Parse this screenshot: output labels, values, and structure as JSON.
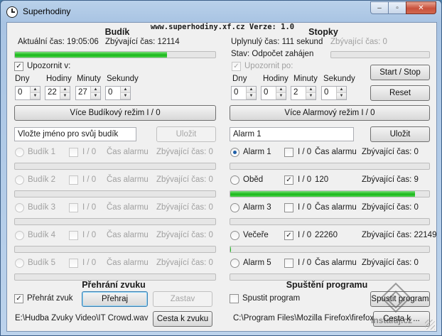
{
  "window": {
    "title": "Superhodiny",
    "caption_min": "–",
    "caption_max": "▫",
    "caption_close": "✕"
  },
  "header": {
    "site": "www.superhodiny.xf.cz  Verze: 1.0"
  },
  "budik": {
    "title": "Budík",
    "current_time": "Aktuální čas: 19:05:06",
    "remaining": "Zbývající čas: 12114",
    "progress": 0.76,
    "notify_label": "Upozornit v:",
    "notify_checked": "✓",
    "labels": {
      "dny": "Dny",
      "hodiny": "Hodiny",
      "minuty": "Minuty",
      "sekundy": "Sekundy"
    },
    "values": {
      "dny": "0",
      "hodiny": "22",
      "minuty": "27",
      "sekundy": "0"
    },
    "mode_button": "Více Budíkový režim I / 0",
    "name_input": "Vložte jméno pro svůj budík",
    "save_button": "Uložit",
    "items": [
      {
        "name": "Budík 1",
        "io": "I / 0",
        "time": "Čas alarmu",
        "remaining": "Zbývající čas: 0"
      },
      {
        "name": "Budík 2",
        "io": "I / 0",
        "time": "Čas alarmu",
        "remaining": "Zbývající čas: 0"
      },
      {
        "name": "Budík 3",
        "io": "I / 0",
        "time": "Čas alarmu",
        "remaining": "Zbývající čas: 0"
      },
      {
        "name": "Budík 4",
        "io": "I / 0",
        "time": "Čas alarmu",
        "remaining": "Zbývající čas: 0"
      },
      {
        "name": "Budík 5",
        "io": "I / 0",
        "time": "Čas alarmu",
        "remaining": "Zbývající čas: 0"
      }
    ]
  },
  "stopky": {
    "title": "Stopky",
    "elapsed": "Uplynulý čas: 111 sekund",
    "remaining": "Zbývající čas: 0",
    "state": "Stav: Odpočet zahájen",
    "notify_label": "Upozornit po:",
    "notify_checked": "✓",
    "labels": {
      "dny": "Dny",
      "hodiny": "Hodiny",
      "minuty": "Minuty",
      "sekundy": "Sekundy"
    },
    "values": {
      "dny": "0",
      "hodiny": "0",
      "minuty": "2",
      "sekundy": "0"
    },
    "start_stop": "Start / Stop",
    "reset": "Reset",
    "mode_button": "Více Alarmový režim I / 0",
    "name_input": "Alarm 1",
    "save_button": "Uložit",
    "items": [
      {
        "name": "Alarm 1",
        "io": "I / 0",
        "checked": "",
        "time": "Čas alarmu",
        "remaining": "Zbývající čas: 0",
        "progress": 0
      },
      {
        "name": "Oběd",
        "io": "I / 0",
        "checked": "✓",
        "time": "120",
        "remaining": "Zbývající čas: 9",
        "progress": 0.93
      },
      {
        "name": "Alarm 3",
        "io": "I / 0",
        "checked": "",
        "time": "Čas alarmu",
        "remaining": "Zbývající čas: 0",
        "progress": 0
      },
      {
        "name": "Večeře",
        "io": "I / 0",
        "checked": "✓",
        "time": "22260",
        "remaining": "Zbývající čas: 22149",
        "progress": 0.005
      },
      {
        "name": "Alarm 5",
        "io": "I / 0",
        "checked": "",
        "time": "Čas alarmu",
        "remaining": "Zbývající čas: 0",
        "progress": 0
      }
    ]
  },
  "zvuk": {
    "title": "Přehrání zvuku",
    "play_check": "Přehrát zvuk",
    "play_checked": "✓",
    "play_button": "Přehraj",
    "stop_button": "Zastav",
    "path": "E:\\Hudba Zvuky Video\\IT Crowd.wav",
    "path_button": "Cesta  k zvuku"
  },
  "program": {
    "title": "Spuštění programu",
    "run_check": "Spustit program",
    "run_button": "Spustit program",
    "path": "C:\\Program Files\\Mozilla Firefox\\firefox.exe",
    "path_button": "Cesta k ..."
  },
  "watermark": {
    "text": "Instaluj.cz"
  }
}
